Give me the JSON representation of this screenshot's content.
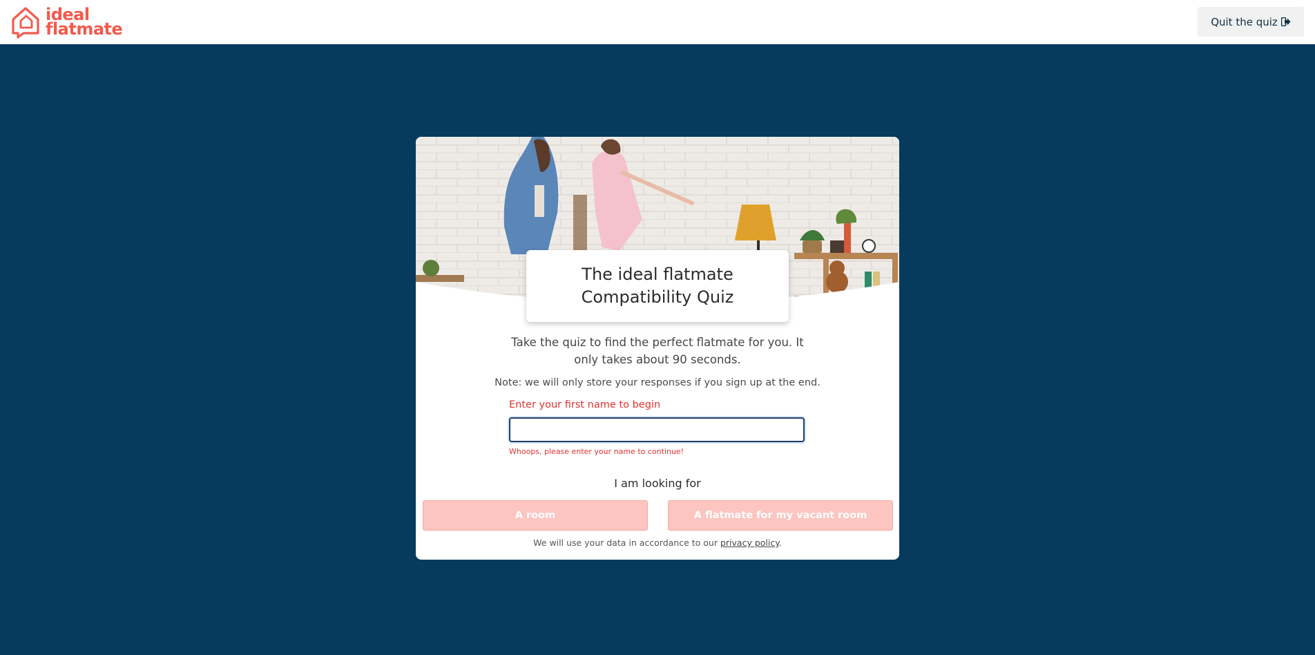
{
  "header": {
    "logo_line1": "ideal",
    "logo_line2": "flatmate",
    "quit_label": "Quit the quiz",
    "quit_icon": "sign-out-icon"
  },
  "quiz": {
    "title_line1": "The ideal flatmate",
    "title_line2": "Compatibility Quiz",
    "intro": "Take the quiz to find the perfect flatmate for you. It only takes about 90 seconds.",
    "note": "Note: we will only store your responses if you sign up at the end.",
    "name_label": "Enter your first name to begin",
    "name_value": "",
    "name_error": "Whoops, please enter your name to continue!",
    "looking_for_label": "I am looking for",
    "option_room": "A room",
    "option_flatmate": "A flatmate for my vacant room",
    "privacy_prefix": "We will use your data in accordance to our ",
    "privacy_link": "privacy policy",
    "privacy_suffix": "."
  },
  "colors": {
    "page_bg": "#073b5d",
    "brand_coral": "#f15a4d",
    "error_red": "#e3312f",
    "button_disabled_bg": "#fcc5c0"
  }
}
